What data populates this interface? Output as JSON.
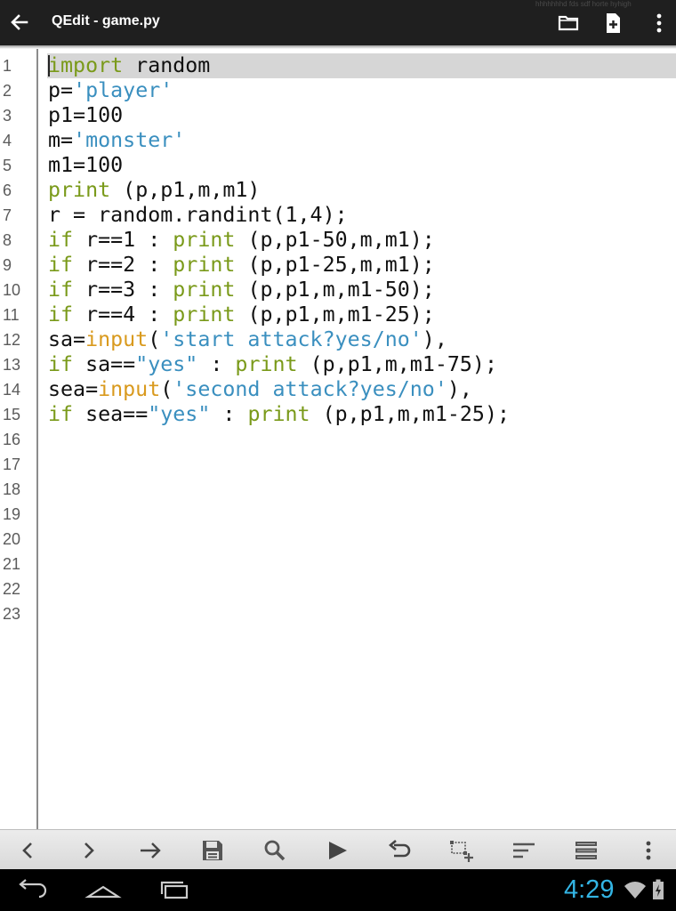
{
  "app": {
    "title": "QEdit - game.py",
    "watermark": "hhhhhhhd fds sdf horte hyhigh"
  },
  "actionbar": {
    "back_icon": "arrow-left-icon",
    "open_icon": "folder-icon",
    "new_icon": "new-file-icon",
    "overflow_icon": "overflow-menu-icon"
  },
  "editor": {
    "line_numbers": [
      "1",
      "2",
      "3",
      "4",
      "5",
      "6",
      "7",
      "8",
      "9",
      "10",
      "11",
      "12",
      "13",
      "14",
      "15",
      "16",
      "17",
      "18",
      "19",
      "20",
      "21",
      "22",
      "23"
    ],
    "highlighted_line": 1,
    "lines": [
      [
        {
          "t": "import",
          "c": "kw"
        },
        {
          "t": " random",
          "c": "pl"
        }
      ],
      [
        {
          "t": "p=",
          "c": "pl"
        },
        {
          "t": "'player'",
          "c": "str"
        }
      ],
      [
        {
          "t": "p1=100",
          "c": "pl"
        }
      ],
      [
        {
          "t": "m=",
          "c": "pl"
        },
        {
          "t": "'monster'",
          "c": "str"
        }
      ],
      [
        {
          "t": "m1=100",
          "c": "pl"
        }
      ],
      [
        {
          "t": "print",
          "c": "kw"
        },
        {
          "t": " (p,p1,m,m1)",
          "c": "pl"
        }
      ],
      [
        {
          "t": "r = random.randint(1,4);",
          "c": "pl"
        }
      ],
      [
        {
          "t": "if",
          "c": "kw"
        },
        {
          "t": " r==1 : ",
          "c": "pl"
        },
        {
          "t": "print",
          "c": "kw"
        },
        {
          "t": " (p,p1-50,m,m1);",
          "c": "pl"
        }
      ],
      [
        {
          "t": "if",
          "c": "kw"
        },
        {
          "t": " r==2 : ",
          "c": "pl"
        },
        {
          "t": "print",
          "c": "kw"
        },
        {
          "t": " (p,p1-25,m,m1);",
          "c": "pl"
        }
      ],
      [
        {
          "t": "if",
          "c": "kw"
        },
        {
          "t": " r==3 : ",
          "c": "pl"
        },
        {
          "t": "print",
          "c": "kw"
        },
        {
          "t": " (p,p1,m,m1-50);",
          "c": "pl"
        }
      ],
      [
        {
          "t": "if",
          "c": "kw"
        },
        {
          "t": " r==4 : ",
          "c": "pl"
        },
        {
          "t": "print",
          "c": "kw"
        },
        {
          "t": " (p,p1,m,m1-25);",
          "c": "pl"
        }
      ],
      [
        {
          "t": "sa=",
          "c": "pl"
        },
        {
          "t": "input",
          "c": "fn"
        },
        {
          "t": "(",
          "c": "pl"
        },
        {
          "t": "'start attack?yes/no'",
          "c": "str"
        },
        {
          "t": "),",
          "c": "pl"
        }
      ],
      [
        {
          "t": "if",
          "c": "kw"
        },
        {
          "t": " sa==",
          "c": "pl"
        },
        {
          "t": "\"yes\"",
          "c": "str"
        },
        {
          "t": " : ",
          "c": "pl"
        },
        {
          "t": "print",
          "c": "kw"
        },
        {
          "t": " (p,p1,m,m1-75);",
          "c": "pl"
        }
      ],
      [
        {
          "t": "sea=",
          "c": "pl"
        },
        {
          "t": "input",
          "c": "fn"
        },
        {
          "t": "(",
          "c": "pl"
        },
        {
          "t": "'second attack?yes/no'",
          "c": "str"
        },
        {
          "t": "),",
          "c": "pl"
        }
      ],
      [
        {
          "t": "if",
          "c": "kw"
        },
        {
          "t": " sea==",
          "c": "pl"
        },
        {
          "t": "\"yes\"",
          "c": "str"
        },
        {
          "t": " : ",
          "c": "pl"
        },
        {
          "t": "print",
          "c": "kw"
        },
        {
          "t": " (p,p1,m,m1-25);",
          "c": "pl"
        }
      ]
    ],
    "colors": {
      "kw": "#7a9a1a",
      "str": "#3a8fbf",
      "fn": "#d99a1e",
      "pl": "#111111",
      "line_highlight": "#d6d6d6"
    }
  },
  "toolbar": {
    "icons": [
      "chevron-left-icon",
      "chevron-right-icon",
      "arrow-right-icon",
      "save-icon",
      "search-icon",
      "run-icon",
      "undo-icon",
      "select-add-icon",
      "align-text-icon",
      "list-icon",
      "overflow-menu-icon"
    ]
  },
  "statusbar": {
    "time": "4:29",
    "time_color": "#33b5e5",
    "nav_icons": [
      "back-nav-icon",
      "home-nav-icon",
      "recents-nav-icon"
    ],
    "status_icons": [
      "wifi-icon",
      "battery-charging-icon"
    ]
  }
}
